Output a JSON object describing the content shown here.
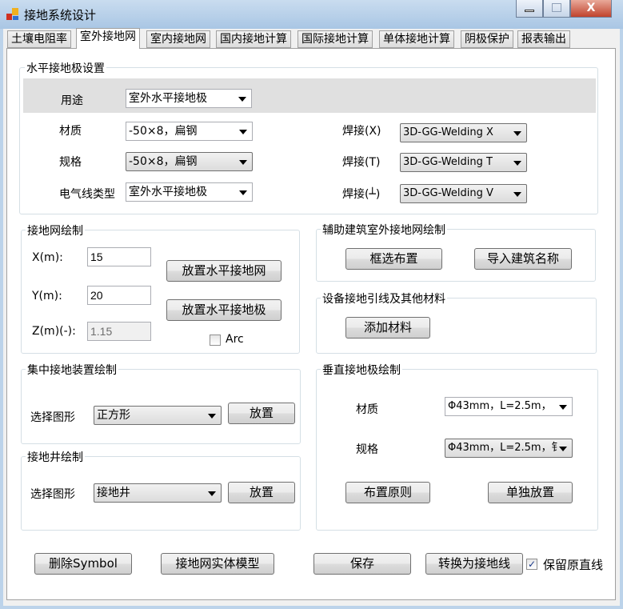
{
  "window": {
    "title": "接地系统设计",
    "close": "X"
  },
  "tabs": [
    "土壤电阻率",
    "室外接地网",
    "室内接地网",
    "国内接地计算",
    "国际接地计算",
    "单体接地计算",
    "阴极保护",
    "报表输出"
  ],
  "horizontal": {
    "title": "水平接地极设置",
    "usage_label": "用途",
    "usage_value": "室外水平接地极",
    "material_label": "材质",
    "material_value": "-50×8，扁钢",
    "spec_label": "规格",
    "spec_value": "-50×8，扁钢",
    "wire_label": "电气线类型",
    "wire_value": "室外水平接地极",
    "weld_x_label": "焊接(X)",
    "weld_x_value": "3D-GG-Welding X",
    "weld_t_label": "焊接(T)",
    "weld_t_value": "3D-GG-Welding T",
    "weld_v_label": "焊接(┴)",
    "weld_v_value": "3D-GG-Welding V"
  },
  "grid": {
    "title": "接地网绘制",
    "x_label": "X(m):",
    "x_value": "15",
    "y_label": "Y(m):",
    "y_value": "20",
    "z_label": "Z(m)(-):",
    "z_value": "1.15",
    "place_grid": "放置水平接地网",
    "place_electrode": "放置水平接地极",
    "arc_label": "Arc",
    "arc_checked": false
  },
  "aux": {
    "title": "辅助建筑室外接地网绘制",
    "select": "框选布置",
    "import": "导入建筑名称"
  },
  "equip": {
    "title": "设备接地引线及其他材料",
    "add": "添加材料"
  },
  "central": {
    "title": "集中接地装置绘制",
    "shape_label": "选择图形",
    "shape_value": "正方形",
    "place": "放置"
  },
  "well": {
    "title": "接地井绘制",
    "shape_label": "选择图形",
    "shape_value": "接地井",
    "place": "放置"
  },
  "vertical": {
    "title": "垂直接地极绘制",
    "material_label": "材质",
    "material_value": "Φ43mm，L=2.5m，",
    "spec_label": "规格",
    "spec_value": "Φ43mm，L=2.5m，钅",
    "principle": "布置原则",
    "single": "单独放置"
  },
  "bottom": {
    "delete": "删除Symbol",
    "solid": "接地网实体模型",
    "save": "保存",
    "convert": "转换为接地线",
    "keep_label": "保留原直线",
    "keep_checked": true
  }
}
